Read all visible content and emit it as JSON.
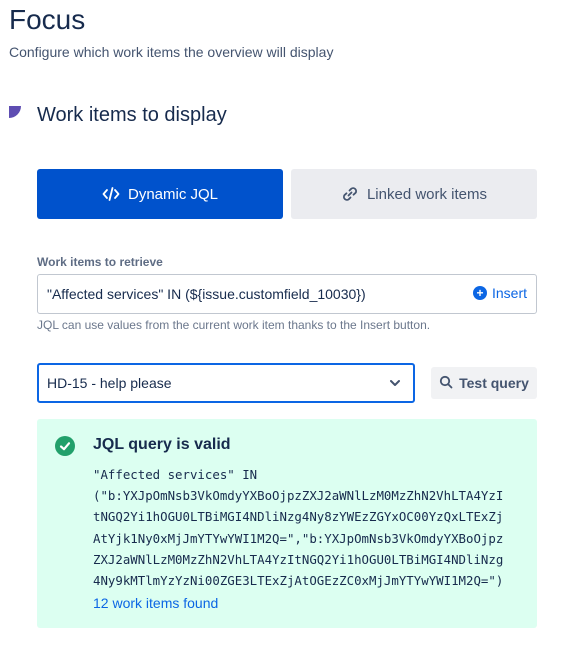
{
  "header": {
    "title": "Focus",
    "subtitle": "Configure which work items the overview will display"
  },
  "section": {
    "title": "Work items to display"
  },
  "mode_toggle": {
    "dynamic_label": "Dynamic JQL",
    "dynamic_icon": "code-icon",
    "linked_label": "Linked work items",
    "linked_icon": "link-icon",
    "selected": "Dynamic JQL"
  },
  "jql_field": {
    "label": "Work items to retrieve",
    "value": "\"Affected services\" IN (${issue.customfield_10030})",
    "insert_label": "Insert",
    "helper": "JQL can use values from the current work item thanks to the Insert button."
  },
  "test_controls": {
    "selected_issue": "HD-15 - help please",
    "test_button_label": "Test query"
  },
  "result": {
    "title": "JQL query is valid",
    "query_lines": [
      "\"Affected services\" IN",
      "(\"b:YXJpOmNsb3VkOmdyYXBoOjpzZXJ2aWNlLzM0MzZhN2VhLTA4YzI",
      "tNGQ2Yi1hOGU0LTBiMGI4NDliNzg4Ny8zYWEzZGYxOC00YzQxLTExZj",
      "AtYjk1Ny0xMjJmYTYwYWI1M2Q=\",\"b:YXJpOmNsb3VkOmdyYXBoOjpz",
      "ZXJ2aWNlLzM0MzZhN2VhLTA4YzItNGQ2Yi1hOGU0LTBiMGI4NDliNzg",
      "4Ny9kMTlmYzYzNi00ZGE3LTExZjAtOGEzZC0xMjJmYTYwYWI1M2Q=\")"
    ],
    "count_text": "12 work items found"
  },
  "colors": {
    "primary": "#0052cc",
    "link": "#0c66e4",
    "success_bg": "#dcfff1",
    "success_icon": "#22a06b",
    "section_marker": "#5e4db2"
  }
}
